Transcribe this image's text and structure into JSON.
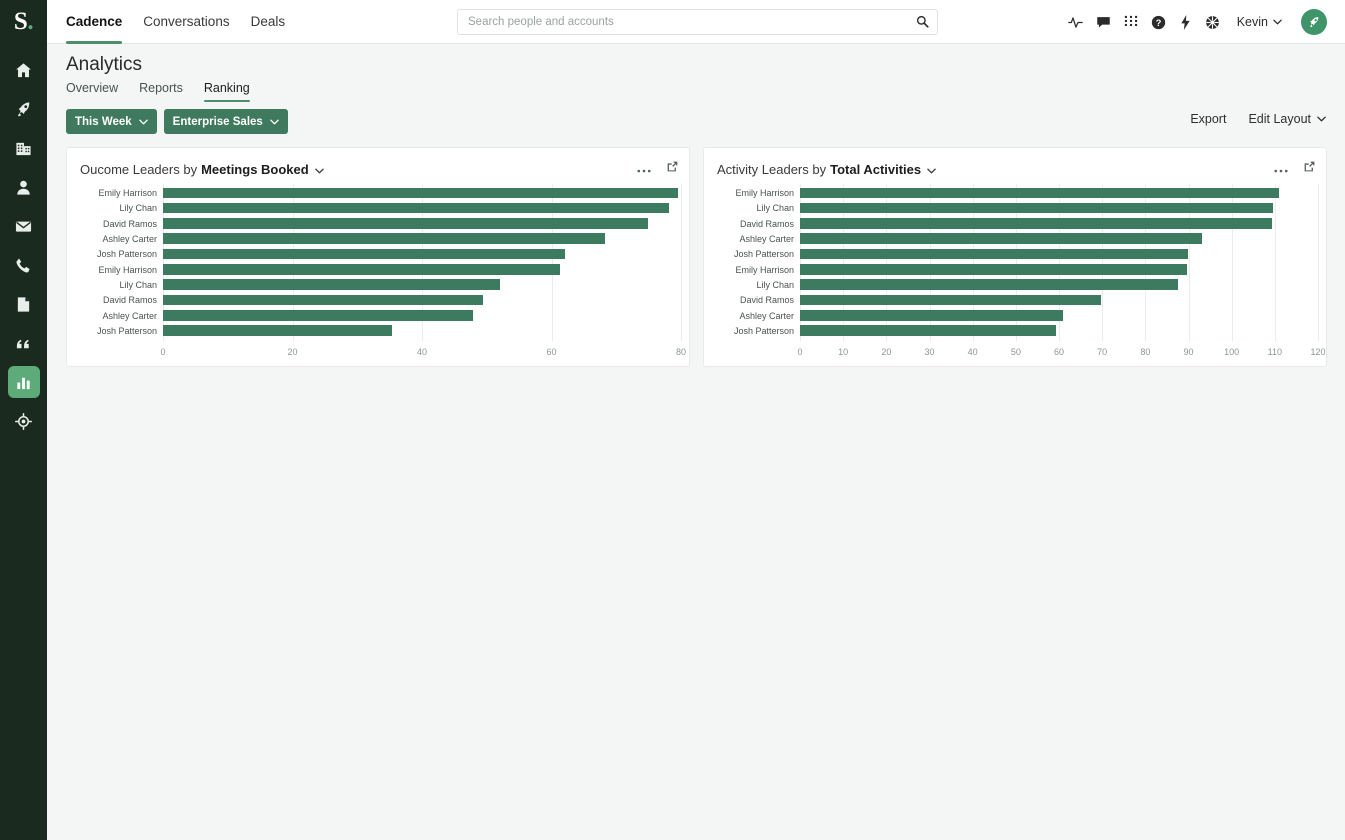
{
  "brand": {
    "logo_letter": "S",
    "logo_dot": ".",
    "accent": "#4d8f6b",
    "bar_color": "#3d7b61",
    "rail_bg": "#1a2a1f",
    "active_nav_bg": "#5cab78"
  },
  "rail": {
    "items": [
      {
        "icon": "home-icon",
        "name": "home"
      },
      {
        "icon": "rocket-icon",
        "name": "cadence"
      },
      {
        "icon": "building-icon",
        "name": "accounts"
      },
      {
        "icon": "person-icon",
        "name": "people"
      },
      {
        "icon": "envelope-icon",
        "name": "email"
      },
      {
        "icon": "phone-icon",
        "name": "calls"
      },
      {
        "icon": "document-icon",
        "name": "templates"
      },
      {
        "icon": "quote-icon",
        "name": "conversations"
      },
      {
        "icon": "bar-chart-icon",
        "name": "analytics",
        "active": true
      },
      {
        "icon": "target-icon",
        "name": "goals"
      }
    ]
  },
  "topnav": {
    "items": [
      {
        "label": "Cadence",
        "active": true
      },
      {
        "label": "Conversations",
        "active": false
      },
      {
        "label": "Deals",
        "active": false
      }
    ]
  },
  "search": {
    "placeholder": "Search people and accounts",
    "value": "",
    "icon": "search-icon"
  },
  "topicons": [
    {
      "name": "activity-pulse-icon"
    },
    {
      "name": "chat-bubble-icon"
    },
    {
      "name": "dialpad-icon"
    },
    {
      "name": "help-circle-icon"
    },
    {
      "name": "lightning-bolt-icon"
    },
    {
      "name": "settings-gear-icon"
    }
  ],
  "user": {
    "name": "Kevin",
    "avatar_icon": "rocket-avatar-icon"
  },
  "page": {
    "title": "Analytics",
    "tabs": [
      {
        "label": "Overview",
        "active": false
      },
      {
        "label": "Reports",
        "active": false
      },
      {
        "label": "Ranking",
        "active": true
      }
    ],
    "filters": [
      {
        "label": "This Week"
      },
      {
        "label": "Enterprise Sales"
      }
    ],
    "actions": [
      {
        "label": "Export",
        "caret": false
      },
      {
        "label": "Edit Layout",
        "caret": true
      }
    ]
  },
  "cards": [
    {
      "title_prefix": "Oucome Leaders by",
      "title_metric": "Meetings Booked",
      "menu_icon": "more-horizontal-icon",
      "expand_icon": "external-link-icon"
    },
    {
      "title_prefix": "Activity Leaders by",
      "title_metric": "Total Activities",
      "menu_icon": "more-horizontal-icon",
      "expand_icon": "external-link-icon"
    }
  ],
  "chart_data": [
    {
      "type": "bar",
      "orientation": "horizontal",
      "title": "Oucome Leaders by Meetings Booked",
      "xlabel": "",
      "ylabel": "",
      "xlim": [
        0,
        80
      ],
      "ticks": [
        0,
        20,
        40,
        60,
        80
      ],
      "grid": true,
      "legend": "none",
      "categories": [
        "Emily Harrison",
        "Lily Chan",
        "David Ramos",
        "Ashley Carter",
        "Josh Patterson",
        "Emily Harrison",
        "Lily Chan",
        "David Ramos",
        "Ashley Carter",
        "Josh Patterson"
      ],
      "values": [
        79.8,
        78.5,
        75.2,
        68.6,
        62.4,
        61.5,
        52.3,
        49.6,
        48.0,
        35.5
      ]
    },
    {
      "type": "bar",
      "orientation": "horizontal",
      "title": "Activity Leaders by Total Activities",
      "xlabel": "",
      "ylabel": "",
      "xlim": [
        0,
        120
      ],
      "ticks": [
        0,
        10,
        20,
        30,
        40,
        50,
        60,
        70,
        80,
        90,
        100,
        110,
        120
      ],
      "grid": true,
      "legend": "none",
      "categories": [
        "Emily Harrison",
        "Lily Chan",
        "David Ramos",
        "Ashley Carter",
        "Josh Patterson",
        "Emily Harrison",
        "Lily Chan",
        "David Ramos",
        "Ashley Carter",
        "Josh Patterson"
      ],
      "values": [
        111.5,
        110.0,
        109.8,
        93.5,
        90.2,
        90.0,
        88.0,
        70.0,
        61.2,
        59.6
      ]
    }
  ]
}
